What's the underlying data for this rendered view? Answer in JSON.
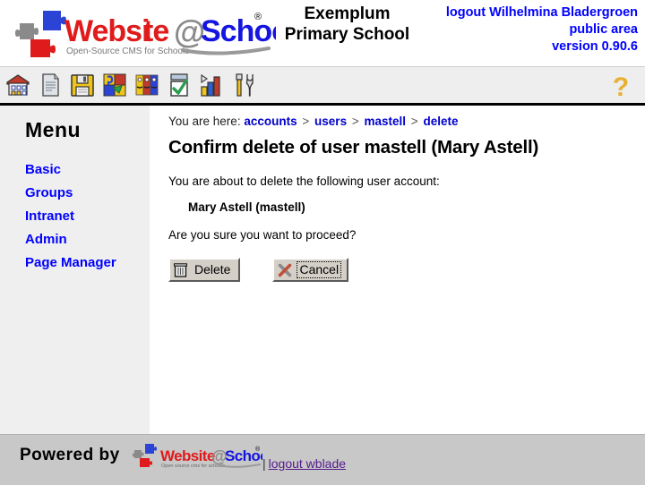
{
  "header": {
    "logo_text": "Website@School",
    "logo_tagline": "Open-Source CMS for Schools",
    "logo_registered": "®",
    "school_name_line1": "Exemplum",
    "school_name_line2": "Primary School",
    "logout_label": "logout Wilhelmina Bladergroen",
    "area_label": "public area",
    "version_label": "version 0.90.6",
    "link_color": "#0000ff"
  },
  "toolbar": {
    "icons": [
      {
        "name": "home-icon",
        "title": "Home"
      },
      {
        "name": "page-icon",
        "title": "Page"
      },
      {
        "name": "save-floppy-icon",
        "title": "Save"
      },
      {
        "name": "modules-puzzle-icon",
        "title": "Modules"
      },
      {
        "name": "accounts-faces-icon",
        "title": "Accounts"
      },
      {
        "name": "tasks-check-icon",
        "title": "Tasks"
      },
      {
        "name": "statistics-chart-icon",
        "title": "Statistics"
      },
      {
        "name": "tools-icon",
        "title": "Tools"
      }
    ],
    "help": {
      "name": "help-question-icon",
      "label": "?",
      "color": "#e8b133"
    }
  },
  "sidebar": {
    "title": "Menu",
    "items": [
      {
        "label": "Basic"
      },
      {
        "label": "Groups"
      },
      {
        "label": "Intranet"
      },
      {
        "label": "Admin"
      },
      {
        "label": "Page Manager"
      }
    ]
  },
  "main": {
    "breadcrumb": {
      "prefix": "You are here:",
      "items": [
        "accounts",
        "users",
        "mastell",
        "delete"
      ],
      "separator": ">"
    },
    "page_title": "Confirm delete of user mastell (Mary Astell)",
    "intro_text": "You are about to delete the following user account:",
    "account_name": "Mary Astell (mastell)",
    "confirm_text": "Are you sure you want to proceed?",
    "buttons": {
      "delete": {
        "label": "Delete",
        "icon": "trash-icon",
        "focused": false
      },
      "cancel": {
        "label": "Cancel",
        "icon": "cross-x-icon",
        "focused": true
      }
    }
  },
  "footer": {
    "powered_by": "Powered by",
    "logo_text": "Website@School",
    "logo_tagline": "Open source cms for schools",
    "separator": "|",
    "logout_label": "logout wblade",
    "link_color": "#551a8b"
  }
}
